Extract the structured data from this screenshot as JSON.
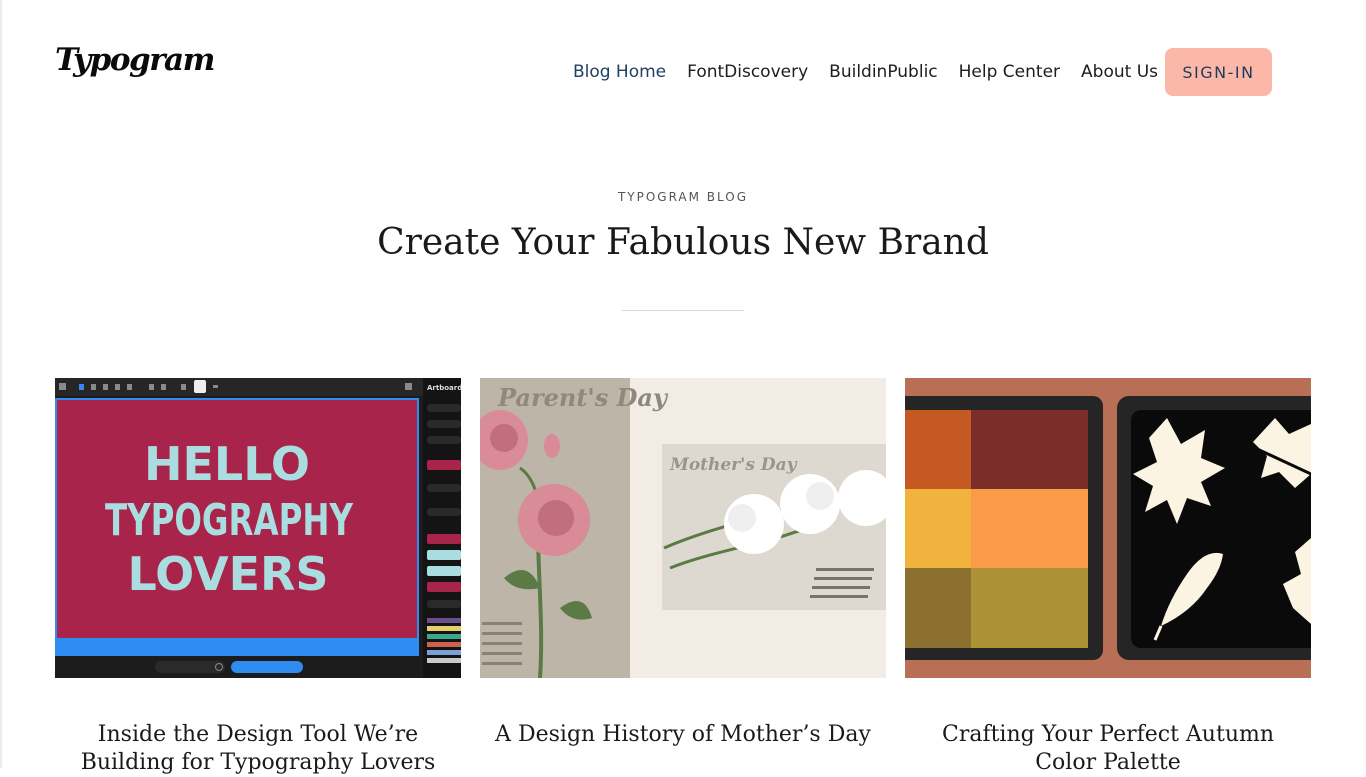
{
  "brand": {
    "logo_text": "Typogram"
  },
  "nav": {
    "items": [
      {
        "label": "Blog Home",
        "active": true
      },
      {
        "label": "FontDiscovery",
        "active": false
      },
      {
        "label": "BuildinPublic",
        "active": false
      },
      {
        "label": "Help Center",
        "active": false
      },
      {
        "label": "About Us",
        "active": false
      }
    ],
    "signin_label": "SIGN-IN"
  },
  "hero": {
    "eyebrow": "TYPOGRAM BLOG",
    "title": "Create Your Fabulous New Brand"
  },
  "posts": [
    {
      "title": "Inside the Design Tool We’re Building for Typography Lovers",
      "image": {
        "description": "design tool screenshot",
        "artwork_lines": [
          "HELLO",
          "TYPOGRAPHY",
          "LOVERS"
        ],
        "panel_title": "Artboard",
        "colors": {
          "canvas": "#a8244a",
          "lettering": "#a9dde0",
          "toolbar": "#1c1c1c",
          "bottom_bar": "#2f8cf0"
        }
      }
    },
    {
      "title": "A Design History of Mother’s Day",
      "image": {
        "description": "vintage postcards with roses and carnations",
        "left_card_heading": "Parent's Day",
        "right_card_heading": "Mother's Day",
        "colors": {
          "left_card": "#bdb6a8",
          "right_card": "#ddd9d0",
          "background": "#f3ece4",
          "rose": "#d98b98"
        }
      }
    },
    {
      "title": "Crafting Your Perfect Autumn Color Palette",
      "image": {
        "description": "autumn palette swatches and leaves",
        "swatches": [
          "#c45a22",
          "#7b2d2a",
          "#f1b33d",
          "#fb9a49",
          "#8c7030",
          "#ad9235"
        ],
        "colors": {
          "background": "#b96f55",
          "panel": "#252525",
          "leaf_panel": "#0a0a0a",
          "leaf": "#fbf4e2"
        }
      }
    }
  ]
}
